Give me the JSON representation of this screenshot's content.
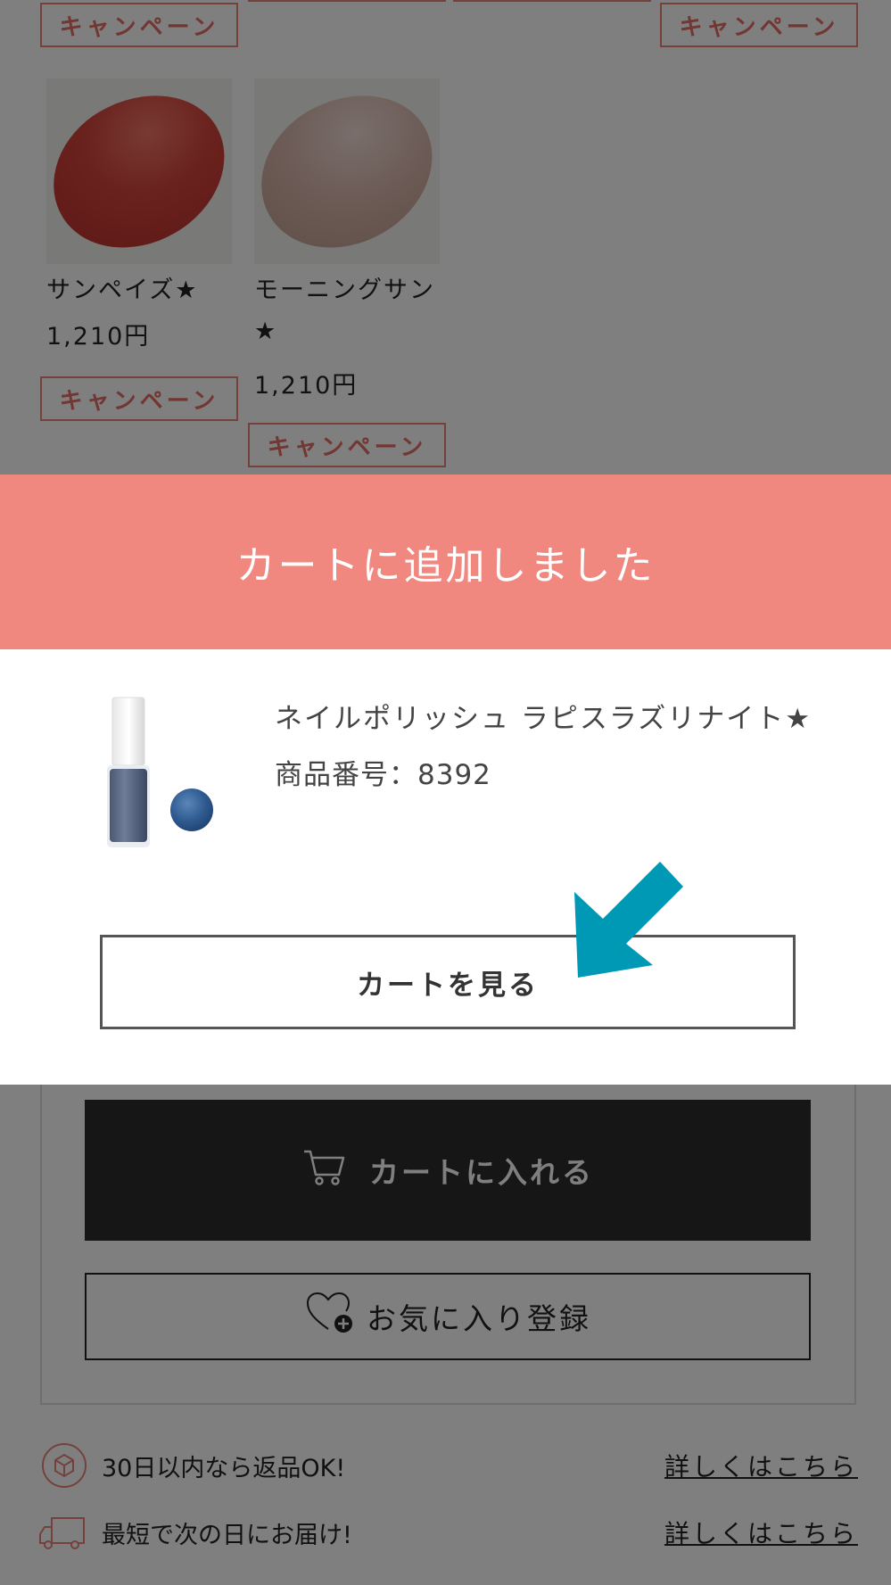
{
  "background": {
    "campaign_label": "キャンペーン",
    "products": [
      {
        "name": "サンペイズ★",
        "price": "1,210円",
        "color": "#d4443c"
      },
      {
        "name_line1": "モーニングサン",
        "name_line2": "★",
        "price": "1,210円",
        "color": "#d9b7ac"
      }
    ],
    "cart_button_label": "カートに入れる",
    "favorite_button_label": "お気に入り登録",
    "info_rows": [
      {
        "text": "30日以内なら返品OK!",
        "link": "詳しくはこちら"
      },
      {
        "text": "最短で次の日にお届け!",
        "link": "詳しくはこちら"
      }
    ]
  },
  "modal": {
    "header_title": "カートに追加しました",
    "product_name": "ネイルポリッシュ ラピスラズリナイト★",
    "product_code": "商品番号：8392",
    "view_cart_label": "カートを見る",
    "accent_color": "#f08880",
    "arrow_color": "#0099b5"
  }
}
